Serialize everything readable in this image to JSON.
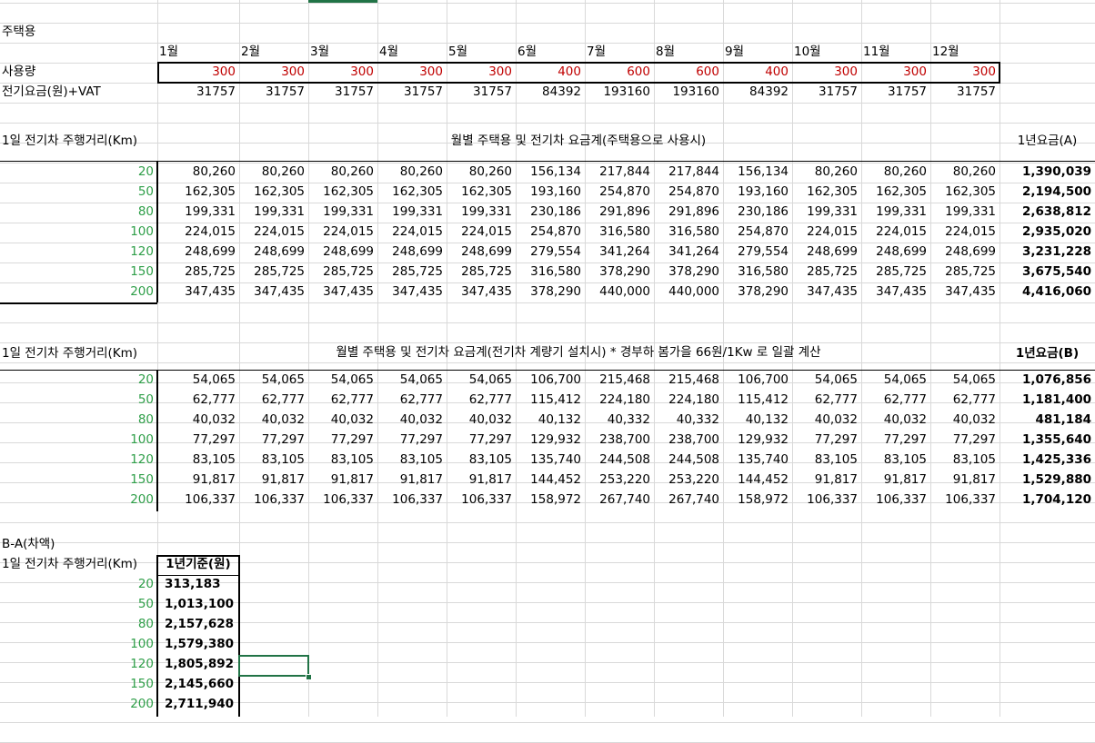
{
  "sheet": {
    "residential_label": "주택용",
    "months": [
      "1월",
      "2월",
      "3월",
      "4월",
      "5월",
      "6월",
      "7월",
      "8월",
      "9월",
      "10월",
      "11월",
      "12월"
    ],
    "usage_label": "사용량",
    "usage": [
      "300",
      "300",
      "300",
      "300",
      "300",
      "400",
      "600",
      "600",
      "400",
      "300",
      "300",
      "300"
    ],
    "fee_label": "전기요금(원)+VAT",
    "fee": [
      "31757",
      "31757",
      "31757",
      "31757",
      "31757",
      "84392",
      "193160",
      "193160",
      "84392",
      "31757",
      "31757",
      "31757"
    ],
    "tableA": {
      "row_header": "1일 전기차 주행거리(Km)",
      "title": "월별 주택용 및 전기차 요금계(주택용으로 사용시)",
      "total_header": "1년요금(A)",
      "rows": [
        {
          "km": "20",
          "m": [
            "80,260",
            "80,260",
            "80,260",
            "80,260",
            "80,260",
            "156,134",
            "217,844",
            "217,844",
            "156,134",
            "80,260",
            "80,260",
            "80,260"
          ],
          "total": "1,390,039"
        },
        {
          "km": "50",
          "m": [
            "162,305",
            "162,305",
            "162,305",
            "162,305",
            "162,305",
            "193,160",
            "254,870",
            "254,870",
            "193,160",
            "162,305",
            "162,305",
            "162,305"
          ],
          "total": "2,194,500"
        },
        {
          "km": "80",
          "m": [
            "199,331",
            "199,331",
            "199,331",
            "199,331",
            "199,331",
            "230,186",
            "291,896",
            "291,896",
            "230,186",
            "199,331",
            "199,331",
            "199,331"
          ],
          "total": "2,638,812"
        },
        {
          "km": "100",
          "m": [
            "224,015",
            "224,015",
            "224,015",
            "224,015",
            "224,015",
            "254,870",
            "316,580",
            "316,580",
            "254,870",
            "224,015",
            "224,015",
            "224,015"
          ],
          "total": "2,935,020"
        },
        {
          "km": "120",
          "m": [
            "248,699",
            "248,699",
            "248,699",
            "248,699",
            "248,699",
            "279,554",
            "341,264",
            "341,264",
            "279,554",
            "248,699",
            "248,699",
            "248,699"
          ],
          "total": "3,231,228"
        },
        {
          "km": "150",
          "m": [
            "285,725",
            "285,725",
            "285,725",
            "285,725",
            "285,725",
            "316,580",
            "378,290",
            "378,290",
            "316,580",
            "285,725",
            "285,725",
            "285,725"
          ],
          "total": "3,675,540"
        },
        {
          "km": "200",
          "m": [
            "347,435",
            "347,435",
            "347,435",
            "347,435",
            "347,435",
            "378,290",
            "440,000",
            "440,000",
            "378,290",
            "347,435",
            "347,435",
            "347,435"
          ],
          "total": "4,416,060"
        }
      ]
    },
    "tableB": {
      "row_header": "1일 전기차 주행거리(Km)",
      "title": "월별 주택용 및 전기차 요금계(전기차 계량기 설치시) * 경부하 봄가을 66원/1Kw 로 일괄 계산",
      "total_header": "1년요금(B)",
      "rows": [
        {
          "km": "20",
          "m": [
            "54,065",
            "54,065",
            "54,065",
            "54,065",
            "54,065",
            "106,700",
            "215,468",
            "215,468",
            "106,700",
            "54,065",
            "54,065",
            "54,065"
          ],
          "total": "1,076,856"
        },
        {
          "km": "50",
          "m": [
            "62,777",
            "62,777",
            "62,777",
            "62,777",
            "62,777",
            "115,412",
            "224,180",
            "224,180",
            "115,412",
            "62,777",
            "62,777",
            "62,777"
          ],
          "total": "1,181,400"
        },
        {
          "km": "80",
          "m": [
            "40,032",
            "40,032",
            "40,032",
            "40,032",
            "40,032",
            "40,132",
            "40,332",
            "40,332",
            "40,132",
            "40,032",
            "40,032",
            "40,032"
          ],
          "total": "481,184"
        },
        {
          "km": "100",
          "m": [
            "77,297",
            "77,297",
            "77,297",
            "77,297",
            "77,297",
            "129,932",
            "238,700",
            "238,700",
            "129,932",
            "77,297",
            "77,297",
            "77,297"
          ],
          "total": "1,355,640"
        },
        {
          "km": "120",
          "m": [
            "83,105",
            "83,105",
            "83,105",
            "83,105",
            "83,105",
            "135,740",
            "244,508",
            "244,508",
            "135,740",
            "83,105",
            "83,105",
            "83,105"
          ],
          "total": "1,425,336"
        },
        {
          "km": "150",
          "m": [
            "91,817",
            "91,817",
            "91,817",
            "91,817",
            "91,817",
            "144,452",
            "253,220",
            "253,220",
            "144,452",
            "91,817",
            "91,817",
            "91,817"
          ],
          "total": "1,529,880"
        },
        {
          "km": "200",
          "m": [
            "106,337",
            "106,337",
            "106,337",
            "106,337",
            "106,337",
            "158,972",
            "267,740",
            "267,740",
            "158,972",
            "106,337",
            "106,337",
            "106,337"
          ],
          "total": "1,704,120"
        }
      ]
    },
    "diff": {
      "label": "B-A(차액)",
      "row_header": "1일 전기차 주행거리(Km)",
      "col_header": "1년기준(원)",
      "rows": [
        {
          "km": "20",
          "v": "313,183"
        },
        {
          "km": "50",
          "v": "1,013,100"
        },
        {
          "km": "80",
          "v": "2,157,628"
        },
        {
          "km": "100",
          "v": "1,579,380"
        },
        {
          "km": "120",
          "v": "1,805,892"
        },
        {
          "km": "150",
          "v": "2,145,660"
        },
        {
          "km": "200",
          "v": "2,711,940"
        }
      ]
    },
    "colors": {
      "usage_text": "#c00000",
      "km_text": "#2e9e48",
      "selection": "#217346",
      "gridline": "#d9d9d9"
    }
  }
}
